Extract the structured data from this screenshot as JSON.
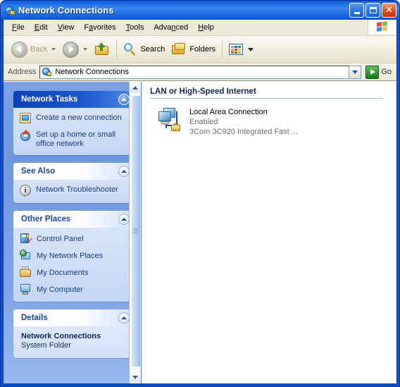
{
  "window": {
    "title": "Network Connections",
    "title_icon": "network-globe-icon",
    "minimize_label": "Minimize",
    "maximize_label": "Maximize",
    "close_label": "Close"
  },
  "menu": {
    "items": [
      {
        "label": "File",
        "accel": "F"
      },
      {
        "label": "Edit",
        "accel": "E"
      },
      {
        "label": "View",
        "accel": "V"
      },
      {
        "label": "Favorites",
        "accel": "a"
      },
      {
        "label": "Tools",
        "accel": "T"
      },
      {
        "label": "Advanced",
        "accel": "n"
      },
      {
        "label": "Help",
        "accel": "H"
      }
    ],
    "brand_icon": "windows-flag-icon"
  },
  "toolbar": {
    "back_label": "Back",
    "forward_label": "",
    "up_label": "",
    "search_label": "Search",
    "folders_label": "Folders",
    "views_label": ""
  },
  "address": {
    "label": "Address",
    "value": "Network Connections",
    "icon": "network-globe-icon",
    "go_label": "Go"
  },
  "sidebar": {
    "panels": [
      {
        "id": "network-tasks",
        "title": "Network Tasks",
        "style": "blue",
        "items": [
          {
            "label": "Create a new connection",
            "icon": "new-connection-icon"
          },
          {
            "label": "Set up a home or small office network",
            "icon": "home-network-icon"
          }
        ]
      },
      {
        "id": "see-also",
        "title": "See Also",
        "style": "white",
        "items": [
          {
            "label": "Network Troubleshooter",
            "icon": "info-icon"
          }
        ]
      },
      {
        "id": "other-places",
        "title": "Other Places",
        "style": "white",
        "items": [
          {
            "label": "Control Panel",
            "icon": "control-panel-icon"
          },
          {
            "label": "My Network Places",
            "icon": "network-places-icon"
          },
          {
            "label": "My Documents",
            "icon": "my-documents-icon"
          },
          {
            "label": "My Computer",
            "icon": "my-computer-icon"
          }
        ]
      },
      {
        "id": "details",
        "title": "Details",
        "style": "white",
        "detail_title": "Network Connections",
        "detail_subtitle": "System Folder"
      }
    ]
  },
  "content": {
    "group_header": "LAN or High-Speed Internet",
    "connections": [
      {
        "name": "Local Area Connection",
        "status": "Enabled",
        "device": "3Com 3C920 Integrated Fast ...",
        "icon": "lan-connection-icon"
      }
    ]
  },
  "colors": {
    "title_blue": "#1464E0",
    "panel_header_blue": "#0C41B8",
    "sidebar_blue": "#7CA2E3",
    "link_text": "#1C3C8C",
    "close_red": "#E05A2A",
    "go_green": "#2F9B33"
  }
}
